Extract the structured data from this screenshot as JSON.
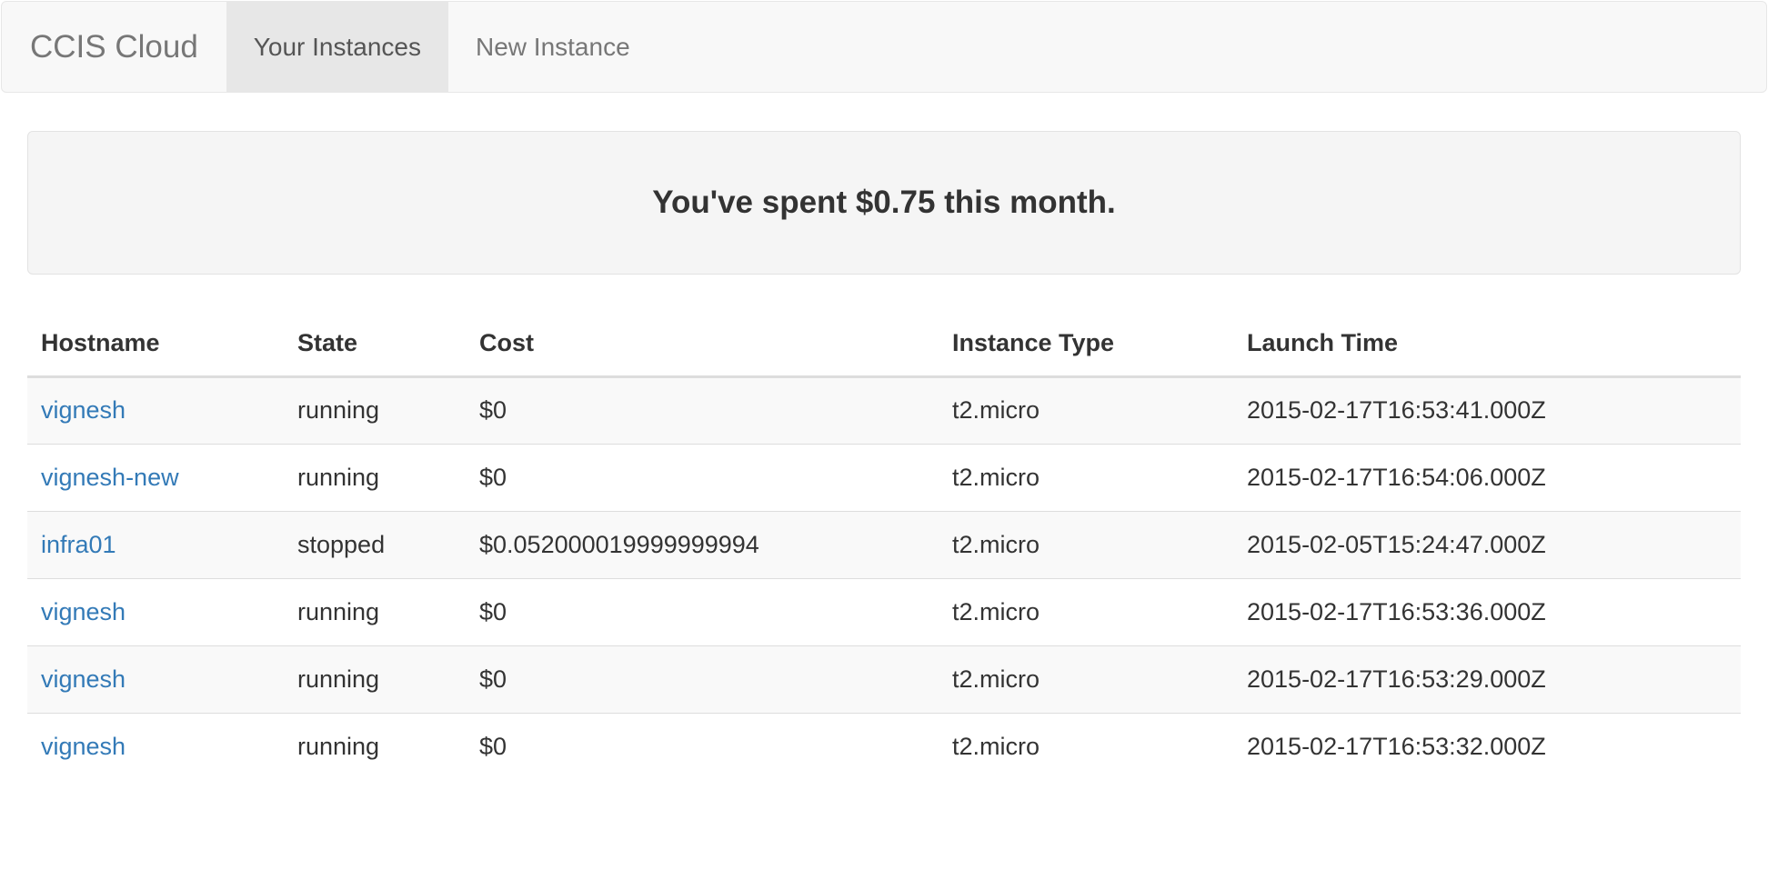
{
  "navbar": {
    "brand": "CCIS Cloud",
    "items": [
      {
        "label": "Your Instances",
        "active": true
      },
      {
        "label": "New Instance",
        "active": false
      }
    ]
  },
  "summary": {
    "text": "You've spent $0.75 this month."
  },
  "table": {
    "headers": [
      "Hostname",
      "State",
      "Cost",
      "Instance Type",
      "Launch Time"
    ],
    "rows": [
      {
        "hostname": "vignesh",
        "state": "running",
        "cost": "$0",
        "instance_type": "t2.micro",
        "launch_time": "2015-02-17T16:53:41.000Z"
      },
      {
        "hostname": "vignesh-new",
        "state": "running",
        "cost": "$0",
        "instance_type": "t2.micro",
        "launch_time": "2015-02-17T16:54:06.000Z"
      },
      {
        "hostname": "infra01",
        "state": "stopped",
        "cost": "$0.052000019999999994",
        "instance_type": "t2.micro",
        "launch_time": "2015-02-05T15:24:47.000Z"
      },
      {
        "hostname": "vignesh",
        "state": "running",
        "cost": "$0",
        "instance_type": "t2.micro",
        "launch_time": "2015-02-17T16:53:36.000Z"
      },
      {
        "hostname": "vignesh",
        "state": "running",
        "cost": "$0",
        "instance_type": "t2.micro",
        "launch_time": "2015-02-17T16:53:29.000Z"
      },
      {
        "hostname": "vignesh",
        "state": "running",
        "cost": "$0",
        "instance_type": "t2.micro",
        "launch_time": "2015-02-17T16:53:32.000Z"
      }
    ]
  },
  "colors": {
    "link": "#337ab7",
    "navbar_bg": "#f8f8f8",
    "nav_active_bg": "#e7e7e7",
    "well_bg": "#f5f5f5",
    "stripe_bg": "#f9f9f9"
  }
}
